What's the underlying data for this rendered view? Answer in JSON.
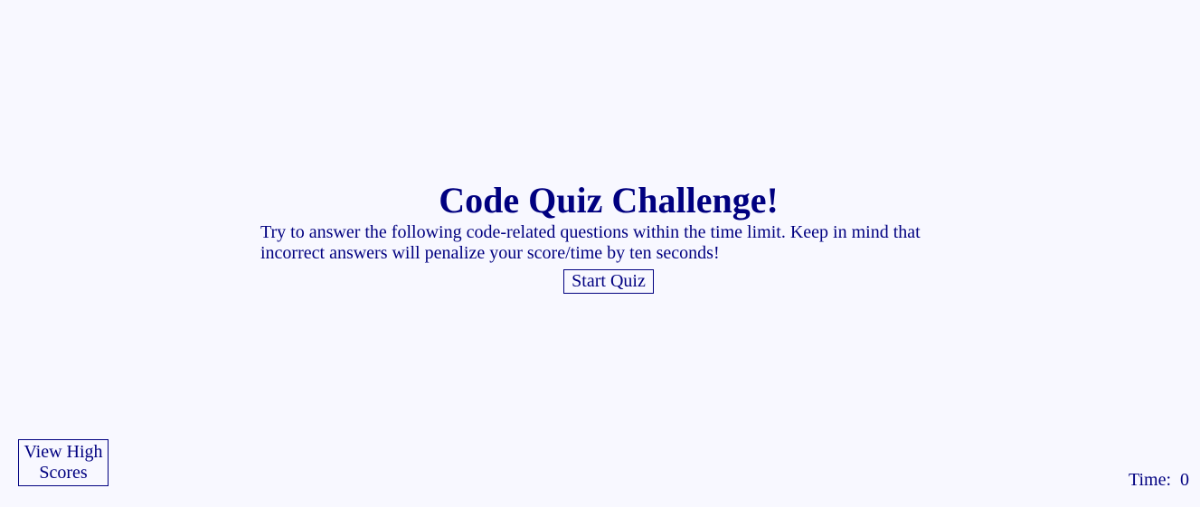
{
  "title": "Code Quiz Challenge!",
  "intro": "Try to answer the following code-related questions within the time limit. Keep in mind that incorrect answers will penalize your score/time by ten seconds!",
  "start_button": "Start Quiz",
  "high_scores_button": "View High Scores",
  "timer": {
    "label": "Time:",
    "value": "0"
  },
  "colors": {
    "background": "#f8f8ff",
    "text": "#000080"
  }
}
